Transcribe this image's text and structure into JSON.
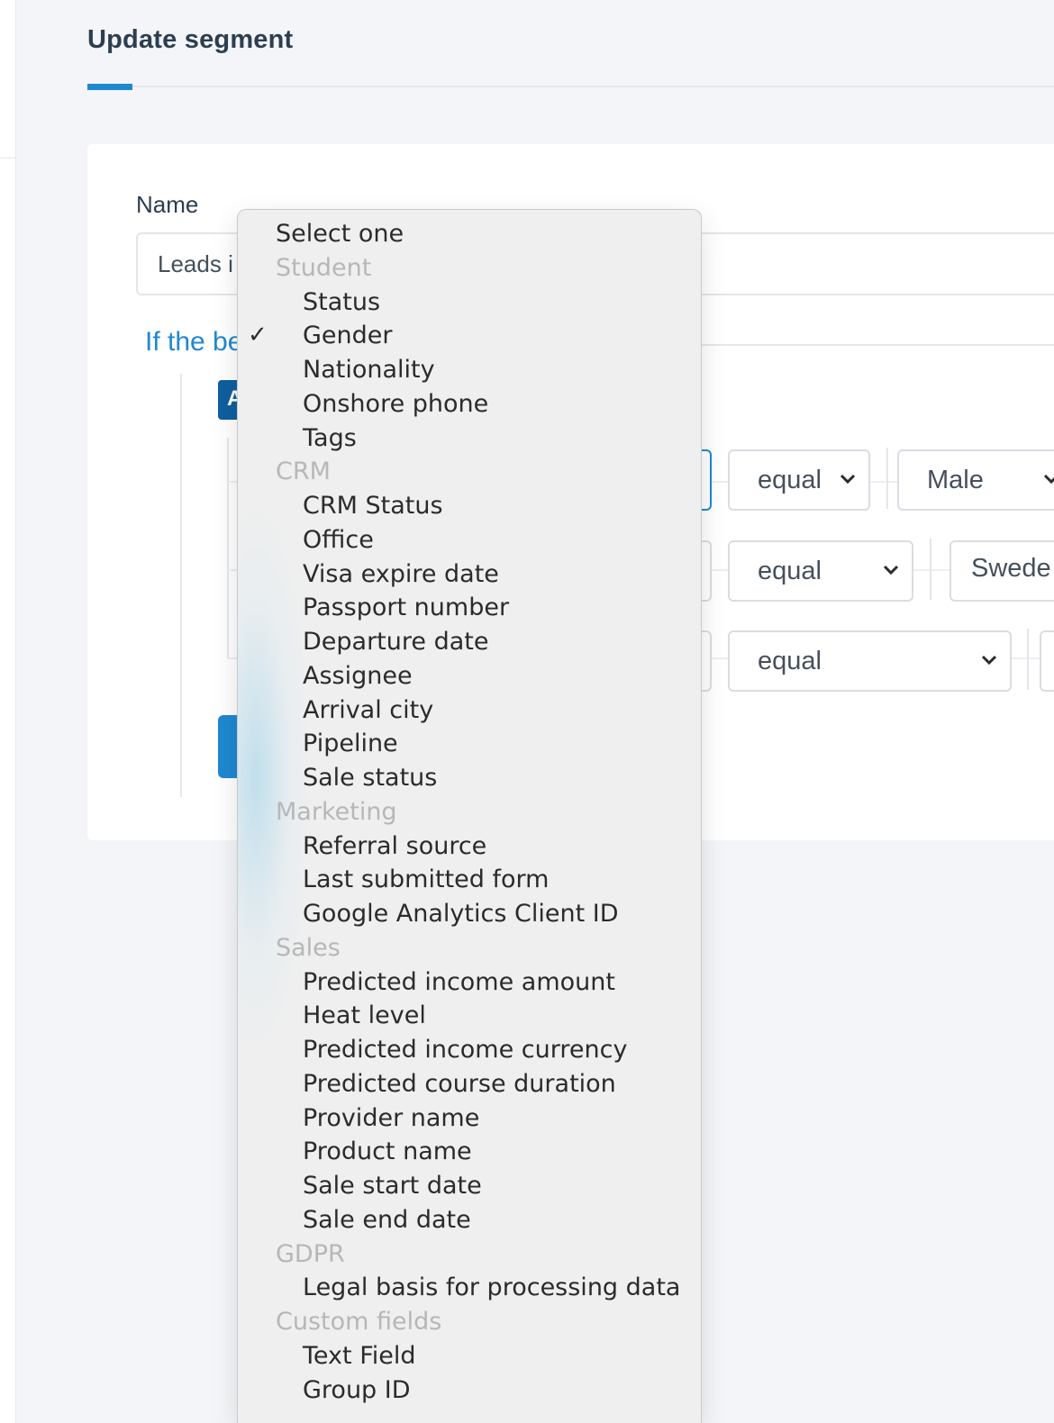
{
  "page": {
    "title": "Update segment"
  },
  "form": {
    "name_label": "Name",
    "name_value": "Leads i",
    "condition_title": "If the be",
    "and_badge": "A"
  },
  "rules": [
    {
      "operator": "equal",
      "value": "Male"
    },
    {
      "operator": "equal",
      "value": "Swede"
    },
    {
      "operator": "equal",
      "value": ""
    }
  ],
  "dropdown": {
    "placeholder": "Select one",
    "selected": "Gender",
    "check_glyph": "✓",
    "groups": [
      {
        "label": "Student",
        "options": [
          "Status",
          "Gender",
          "Nationality",
          "Onshore phone",
          "Tags"
        ]
      },
      {
        "label": "CRM",
        "options": [
          "CRM Status",
          "Office",
          "Visa expire date",
          "Passport number",
          "Departure date",
          "Assignee",
          "Arrival city",
          "Pipeline",
          "Sale status"
        ]
      },
      {
        "label": "Marketing",
        "options": [
          "Referral source",
          "Last submitted form",
          "Google Analytics Client ID"
        ]
      },
      {
        "label": "Sales",
        "options": [
          "Predicted income amount",
          "Heat level",
          "Predicted income currency",
          "Predicted course duration",
          "Provider name",
          "Product name",
          "Sale start date",
          "Sale end date"
        ]
      },
      {
        "label": "GDPR",
        "options": [
          "Legal basis for processing data"
        ]
      },
      {
        "label": "Custom fields",
        "options": [
          "Text Field",
          "Group ID"
        ]
      }
    ]
  },
  "icons": {
    "chevron": "chevron-down-icon",
    "check": "checkmark-icon"
  },
  "colors": {
    "accent": "#1f88d2",
    "badge": "#0f5f9e",
    "group_label": "#b7b7b7"
  }
}
